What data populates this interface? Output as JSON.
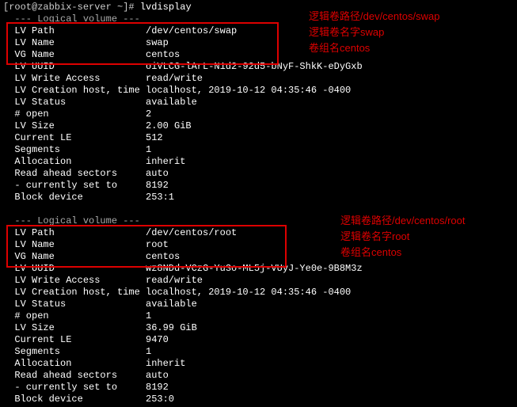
{
  "prompt": "[root@zabbix-server ~]# ",
  "command": "lvdisplay",
  "header": "  --- Logical volume ---",
  "header2": "  --- Logical volume ---",
  "vol1": {
    "path": {
      "k": "  LV Path",
      "v": "/dev/centos/swap"
    },
    "name": {
      "k": "  LV Name",
      "v": "swap"
    },
    "vg": {
      "k": "  VG Name",
      "v": "centos"
    },
    "uuid": {
      "k": "  LV UUID",
      "v": "oiVLCG-lArL-N1d2-92d5-bNyF-ShkK-eDyGxb"
    },
    "wa": {
      "k": "  LV Write Access",
      "v": "read/write"
    },
    "ch": {
      "k": "  LV Creation host, time",
      "v": "localhost, 2019-10-12 04:35:46 -0400"
    },
    "st": {
      "k": "  LV Status",
      "v": "available"
    },
    "open": {
      "k": "  # open",
      "v": "2"
    },
    "size": {
      "k": "  LV Size",
      "v": "2.00 GiB"
    },
    "le": {
      "k": "  Current LE",
      "v": "512"
    },
    "seg": {
      "k": "  Segments",
      "v": "1"
    },
    "alloc": {
      "k": "  Allocation",
      "v": "inherit"
    },
    "ras": {
      "k": "  Read ahead sectors",
      "v": "auto"
    },
    "cur": {
      "k": "  - currently set to",
      "v": "8192"
    },
    "blk": {
      "k": "  Block device",
      "v": "253:1"
    }
  },
  "vol2": {
    "path": {
      "k": "  LV Path",
      "v": "/dev/centos/root"
    },
    "name": {
      "k": "  LV Name",
      "v": "root"
    },
    "vg": {
      "k": "  VG Name",
      "v": "centos"
    },
    "uuid": {
      "k": "  LV UUID",
      "v": "wz8NDd-VCzG-Yu3o-ML5j-VUyJ-Ye0e-9B8M3z"
    },
    "wa": {
      "k": "  LV Write Access",
      "v": "read/write"
    },
    "ch": {
      "k": "  LV Creation host, time",
      "v": "localhost, 2019-10-12 04:35:46 -0400"
    },
    "st": {
      "k": "  LV Status",
      "v": "available"
    },
    "open": {
      "k": "  # open",
      "v": "1"
    },
    "size": {
      "k": "  LV Size",
      "v": "36.99 GiB"
    },
    "le": {
      "k": "  Current LE",
      "v": "9470"
    },
    "seg": {
      "k": "  Segments",
      "v": "1"
    },
    "alloc": {
      "k": "  Allocation",
      "v": "inherit"
    },
    "ras": {
      "k": "  Read ahead sectors",
      "v": "auto"
    },
    "cur": {
      "k": "  - currently set to",
      "v": "8192"
    },
    "blk": {
      "k": "  Block device",
      "v": "253:0"
    }
  },
  "anno1": {
    "l1": "逻辑卷路径/dev/centos/swap",
    "l2": "逻辑卷名字swap",
    "l3": "卷组名centos"
  },
  "anno2": {
    "l1": "逻辑卷路径/dev/centos/root",
    "l2": "逻辑卷名字root",
    "l3": "卷组名centos"
  }
}
